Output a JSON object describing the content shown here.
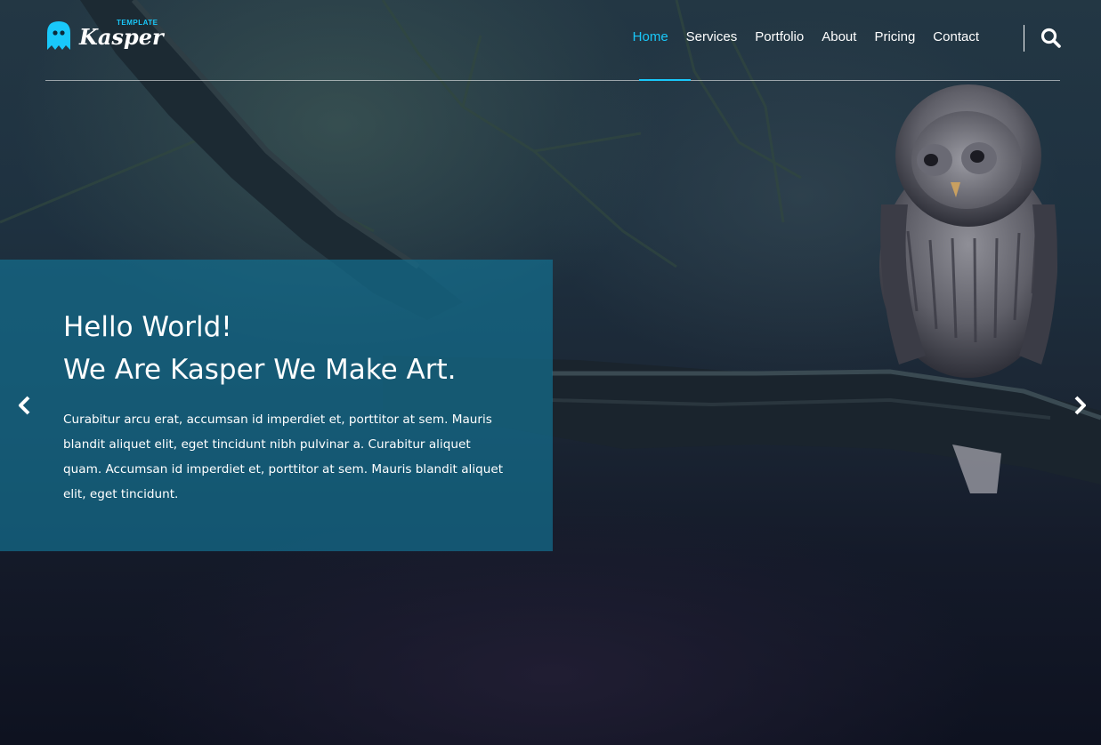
{
  "logo": {
    "name": "Kasper",
    "tag": "TEMPLATE"
  },
  "nav": {
    "items": [
      "Home",
      "Services",
      "Portfolio",
      "About",
      "Pricing",
      "Contact"
    ],
    "active": "Home"
  },
  "hero": {
    "title_line1": "Hello World!",
    "title_line2": "We Are Kasper We Make Art.",
    "paragraph": "Curabitur arcu erat, accumsan id imperdiet et, porttitor at sem. Mauris blandit aliquet elit, eget tincidunt nibh pulvinar a. Curabitur aliquet quam. Accumsan id imperdiet et, porttitor at sem. Mauris blandit aliquet elit, eget tincidunt."
  },
  "icons": {
    "logo": "ghost-icon",
    "search": "search-icon",
    "prev": "chevron-left-icon",
    "next": "chevron-right-icon"
  },
  "colors": {
    "accent": "#19c8fa",
    "caption_bg": "#136e8e",
    "text": "#ffffff"
  }
}
